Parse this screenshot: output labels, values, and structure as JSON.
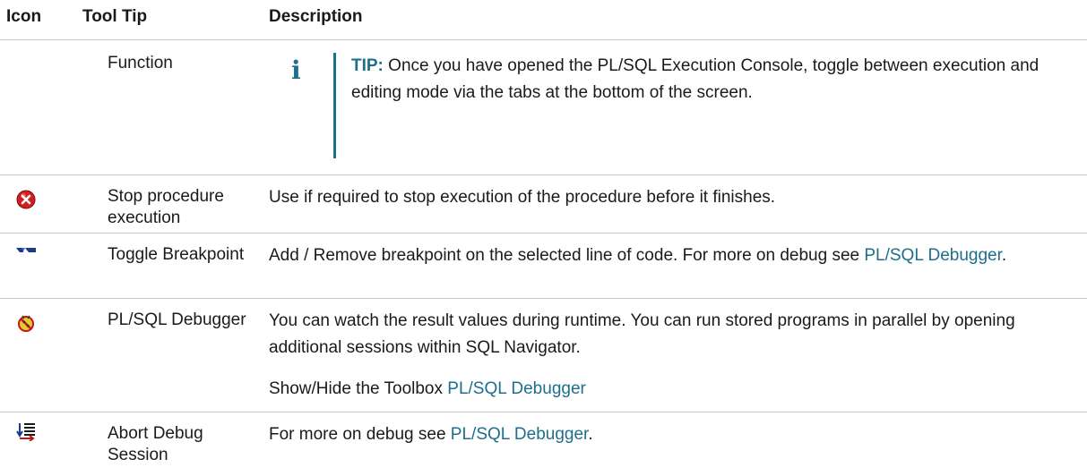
{
  "headers": {
    "icon": "Icon",
    "tooltip": "Tool Tip",
    "description": "Description"
  },
  "rows": [
    {
      "icon": "none",
      "tooltip": "Function",
      "tip_label": "TIP:",
      "tip_text": "Once you have opened the PL/SQL Execution Console, toggle between execution and editing mode via the tabs at the bottom of the screen."
    },
    {
      "icon": "stop-icon",
      "tooltip_line1": "Stop procedure",
      "tooltip_line2": "execution",
      "description": "Use if required to stop execution of the procedure before it finishes."
    },
    {
      "icon": "breakpoint-icon",
      "tooltip": "Toggle Breakpoint",
      "description": "Add / Remove breakpoint on the selected line of code. For more on debug see",
      "link": "PL/SQL Debugger",
      "suffix": "."
    },
    {
      "icon": "debugger-icon",
      "tooltip": "PL/SQL Debugger",
      "description": "You can watch the result values during runtime. You can run stored programs in parallel by opening additional sessions within SQL Navigator.",
      "description2": "Show/Hide the Toolbox",
      "link": "PL/SQL Debugger"
    },
    {
      "icon": "abort-debug-icon",
      "tooltip_line1": "Abort Debug",
      "tooltip_line2": "Session",
      "description": "For more on debug see",
      "link": "PL/SQL Debugger",
      "suffix": "."
    }
  ],
  "colors": {
    "accent": "#1d6f8c",
    "text": "#1a1a1a",
    "divider": "#c8c8c8"
  }
}
